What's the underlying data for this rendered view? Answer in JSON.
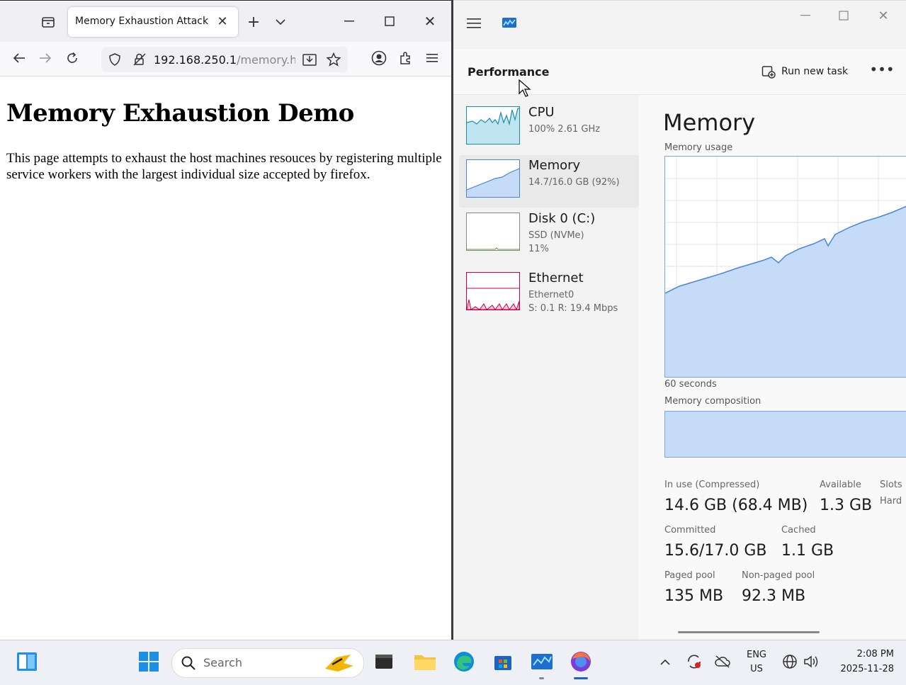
{
  "firefox": {
    "tab_title": "Memory Exhaustion Attack",
    "url_host": "192.168.250.1",
    "url_path": "/memory.htr",
    "page": {
      "heading": "Memory Exhaustion Demo",
      "body": "This page attempts to exhaust the host machines resouces by registering multiple service workers with the largest individual size accepted by firefox."
    }
  },
  "task_manager": {
    "section_title": "Performance",
    "run_new_task": "Run new task",
    "more": "•••",
    "sidebar": [
      {
        "name": "CPU",
        "sub1": "100%  2.61 GHz",
        "sub2": "",
        "sub3": ""
      },
      {
        "name": "Memory",
        "sub1": "14.7/16.0 GB (92%)",
        "sub2": "",
        "sub3": ""
      },
      {
        "name": "Disk 0 (C:)",
        "sub1": "SSD (NVMe)",
        "sub2": "11%",
        "sub3": ""
      },
      {
        "name": "Ethernet",
        "sub1": "Ethernet0",
        "sub2": "S: 0.1  R: 19.4 Mbps",
        "sub3": ""
      }
    ],
    "memory": {
      "title": "Memory",
      "usage_label": "Memory usage",
      "time_label": "60 seconds",
      "composition_label": "Memory composition",
      "stats": {
        "in_use_label": "In use (Compressed)",
        "in_use_value": "14.6 GB (68.4 MB)",
        "available_label": "Available",
        "available_value": "1.3 GB",
        "slots_label": "Slots",
        "hard_label": "Hard",
        "committed_label": "Committed",
        "committed_value": "15.6/17.0 GB",
        "cached_label": "Cached",
        "cached_value": "1.1 GB",
        "paged_label": "Paged pool",
        "paged_value": "135 MB",
        "nonpaged_label": "Non-paged pool",
        "nonpaged_value": "92.3 MB"
      }
    }
  },
  "taskbar": {
    "search_placeholder": "Search",
    "lang_top": "ENG",
    "lang_bottom": "US",
    "time": "2:08 PM",
    "date": "2025-11-28"
  },
  "colors": {
    "graph_fill": "#c6dbf7",
    "graph_line": "#4a86d8",
    "ethernet_line": "#c8004a",
    "cpu_line": "#1b8fa8"
  }
}
